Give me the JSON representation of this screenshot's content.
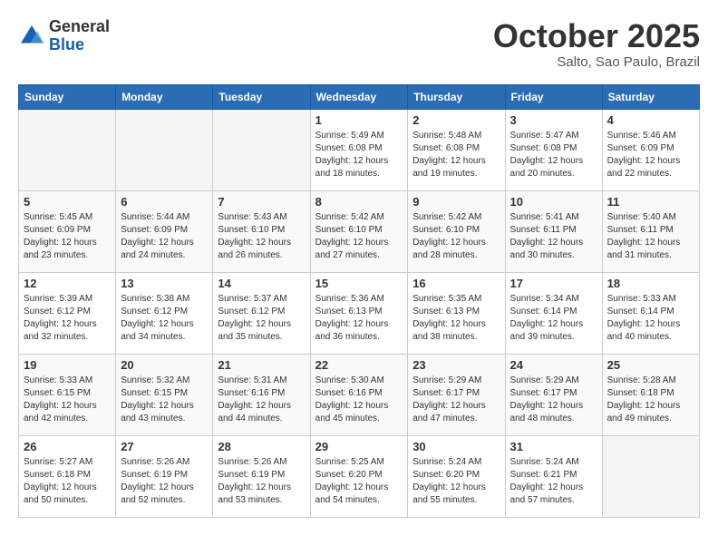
{
  "header": {
    "logo_general": "General",
    "logo_blue": "Blue",
    "month_title": "October 2025",
    "subtitle": "Salto, Sao Paulo, Brazil"
  },
  "weekdays": [
    "Sunday",
    "Monday",
    "Tuesday",
    "Wednesday",
    "Thursday",
    "Friday",
    "Saturday"
  ],
  "weeks": [
    [
      {
        "day": "",
        "empty": true
      },
      {
        "day": "",
        "empty": true
      },
      {
        "day": "",
        "empty": true
      },
      {
        "day": "1",
        "sunrise": "5:49 AM",
        "sunset": "6:08 PM",
        "daylight": "12 hours and 18 minutes."
      },
      {
        "day": "2",
        "sunrise": "5:48 AM",
        "sunset": "6:08 PM",
        "daylight": "12 hours and 19 minutes."
      },
      {
        "day": "3",
        "sunrise": "5:47 AM",
        "sunset": "6:08 PM",
        "daylight": "12 hours and 20 minutes."
      },
      {
        "day": "4",
        "sunrise": "5:46 AM",
        "sunset": "6:09 PM",
        "daylight": "12 hours and 22 minutes."
      }
    ],
    [
      {
        "day": "5",
        "sunrise": "5:45 AM",
        "sunset": "6:09 PM",
        "daylight": "12 hours and 23 minutes."
      },
      {
        "day": "6",
        "sunrise": "5:44 AM",
        "sunset": "6:09 PM",
        "daylight": "12 hours and 24 minutes."
      },
      {
        "day": "7",
        "sunrise": "5:43 AM",
        "sunset": "6:10 PM",
        "daylight": "12 hours and 26 minutes."
      },
      {
        "day": "8",
        "sunrise": "5:42 AM",
        "sunset": "6:10 PM",
        "daylight": "12 hours and 27 minutes."
      },
      {
        "day": "9",
        "sunrise": "5:42 AM",
        "sunset": "6:10 PM",
        "daylight": "12 hours and 28 minutes."
      },
      {
        "day": "10",
        "sunrise": "5:41 AM",
        "sunset": "6:11 PM",
        "daylight": "12 hours and 30 minutes."
      },
      {
        "day": "11",
        "sunrise": "5:40 AM",
        "sunset": "6:11 PM",
        "daylight": "12 hours and 31 minutes."
      }
    ],
    [
      {
        "day": "12",
        "sunrise": "5:39 AM",
        "sunset": "6:12 PM",
        "daylight": "12 hours and 32 minutes."
      },
      {
        "day": "13",
        "sunrise": "5:38 AM",
        "sunset": "6:12 PM",
        "daylight": "12 hours and 34 minutes."
      },
      {
        "day": "14",
        "sunrise": "5:37 AM",
        "sunset": "6:12 PM",
        "daylight": "12 hours and 35 minutes."
      },
      {
        "day": "15",
        "sunrise": "5:36 AM",
        "sunset": "6:13 PM",
        "daylight": "12 hours and 36 minutes."
      },
      {
        "day": "16",
        "sunrise": "5:35 AM",
        "sunset": "6:13 PM",
        "daylight": "12 hours and 38 minutes."
      },
      {
        "day": "17",
        "sunrise": "5:34 AM",
        "sunset": "6:14 PM",
        "daylight": "12 hours and 39 minutes."
      },
      {
        "day": "18",
        "sunrise": "5:33 AM",
        "sunset": "6:14 PM",
        "daylight": "12 hours and 40 minutes."
      }
    ],
    [
      {
        "day": "19",
        "sunrise": "5:33 AM",
        "sunset": "6:15 PM",
        "daylight": "12 hours and 42 minutes."
      },
      {
        "day": "20",
        "sunrise": "5:32 AM",
        "sunset": "6:15 PM",
        "daylight": "12 hours and 43 minutes."
      },
      {
        "day": "21",
        "sunrise": "5:31 AM",
        "sunset": "6:16 PM",
        "daylight": "12 hours and 44 minutes."
      },
      {
        "day": "22",
        "sunrise": "5:30 AM",
        "sunset": "6:16 PM",
        "daylight": "12 hours and 45 minutes."
      },
      {
        "day": "23",
        "sunrise": "5:29 AM",
        "sunset": "6:17 PM",
        "daylight": "12 hours and 47 minutes."
      },
      {
        "day": "24",
        "sunrise": "5:29 AM",
        "sunset": "6:17 PM",
        "daylight": "12 hours and 48 minutes."
      },
      {
        "day": "25",
        "sunrise": "5:28 AM",
        "sunset": "6:18 PM",
        "daylight": "12 hours and 49 minutes."
      }
    ],
    [
      {
        "day": "26",
        "sunrise": "5:27 AM",
        "sunset": "6:18 PM",
        "daylight": "12 hours and 50 minutes."
      },
      {
        "day": "27",
        "sunrise": "5:26 AM",
        "sunset": "6:19 PM",
        "daylight": "12 hours and 52 minutes."
      },
      {
        "day": "28",
        "sunrise": "5:26 AM",
        "sunset": "6:19 PM",
        "daylight": "12 hours and 53 minutes."
      },
      {
        "day": "29",
        "sunrise": "5:25 AM",
        "sunset": "6:20 PM",
        "daylight": "12 hours and 54 minutes."
      },
      {
        "day": "30",
        "sunrise": "5:24 AM",
        "sunset": "6:20 PM",
        "daylight": "12 hours and 55 minutes."
      },
      {
        "day": "31",
        "sunrise": "5:24 AM",
        "sunset": "6:21 PM",
        "daylight": "12 hours and 57 minutes."
      },
      {
        "day": "",
        "empty": true
      }
    ]
  ]
}
